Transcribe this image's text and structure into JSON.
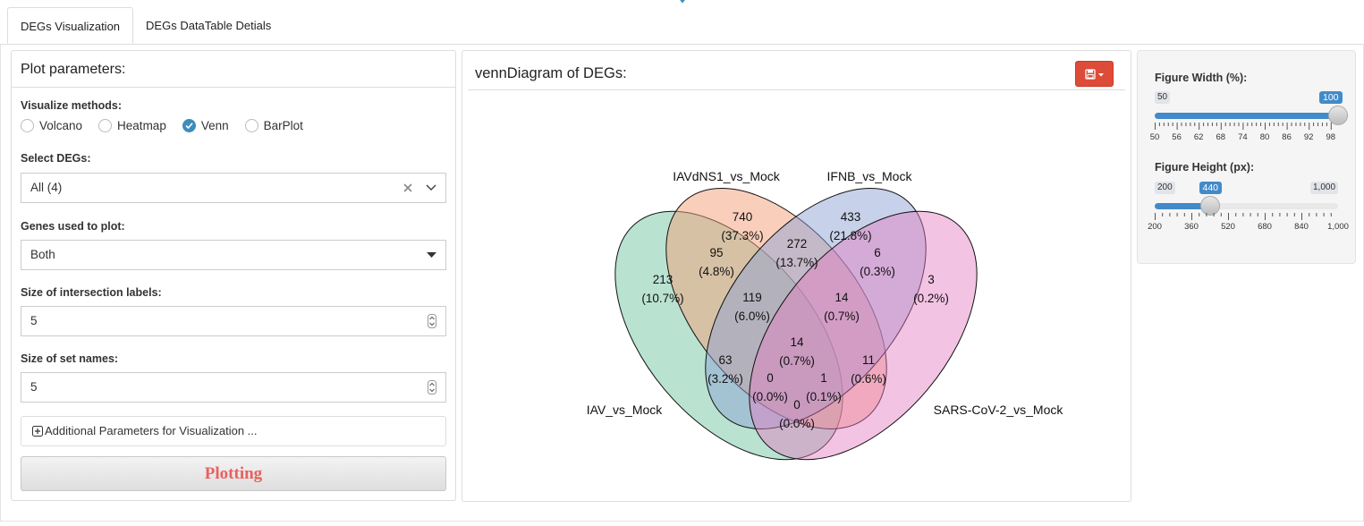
{
  "tabs": [
    {
      "label": "DEGs Visualization",
      "active": true
    },
    {
      "label": "DEGs DataTable Detials",
      "active": false
    }
  ],
  "params": {
    "title": "Plot parameters:",
    "methods_label": "Visualize methods:",
    "methods": [
      {
        "label": "Volcano",
        "checked": false
      },
      {
        "label": "Heatmap",
        "checked": false
      },
      {
        "label": "Venn",
        "checked": true
      },
      {
        "label": "BarPlot",
        "checked": false
      }
    ],
    "degs_label": "Select DEGs:",
    "degs_value": "All (4)",
    "genes_label": "Genes used to plot:",
    "genes_value": "Both",
    "intersect_label": "Size of intersection labels:",
    "intersect_value": "5",
    "setnames_label": "Size of set names:",
    "setnames_value": "5",
    "additional_label": "Additional Parameters for Visualization ...",
    "plot_button": "Plotting"
  },
  "venn_panel": {
    "title": "vennDiagram of DEGs:",
    "save_icon": "floppy-disk-icon",
    "save_color": "#dd4b39"
  },
  "venn": {
    "sets": [
      {
        "name": "IAV_vs_Mock",
        "color": "#74c6a4"
      },
      {
        "name": "IAVdNS1_vs_Mock",
        "color": "#f4a07a"
      },
      {
        "name": "IFNB_vs_Mock",
        "color": "#8fa4d4"
      },
      {
        "name": "SARS-CoV-2_vs_Mock",
        "color": "#e57ac0"
      }
    ],
    "regions": [
      {
        "count": "740",
        "pct": "(37.3%)"
      },
      {
        "count": "433",
        "pct": "(21.8%)"
      },
      {
        "count": "95",
        "pct": "(4.8%)"
      },
      {
        "count": "272",
        "pct": "(13.7%)"
      },
      {
        "count": "6",
        "pct": "(0.3%)"
      },
      {
        "count": "213",
        "pct": "(10.7%)"
      },
      {
        "count": "3",
        "pct": "(0.2%)"
      },
      {
        "count": "119",
        "pct": "(6.0%)"
      },
      {
        "count": "14",
        "pct": "(0.7%)"
      },
      {
        "count": "14",
        "pct": "(0.7%)"
      },
      {
        "count": "63",
        "pct": "(3.2%)"
      },
      {
        "count": "11",
        "pct": "(0.6%)"
      },
      {
        "count": "0",
        "pct": "(0.0%)"
      },
      {
        "count": "1",
        "pct": "(0.1%)"
      },
      {
        "count": "0",
        "pct": "(0.0%)"
      }
    ]
  },
  "sliders": {
    "width": {
      "label": "Figure Width (%):",
      "min": "50",
      "max": "100",
      "value": "100",
      "fraction": 1.0,
      "ticks": [
        "50",
        "56",
        "62",
        "68",
        "74",
        "80",
        "86",
        "92",
        "98"
      ]
    },
    "height": {
      "label": "Figure Height (px):",
      "min": "200",
      "max": "1,000",
      "value": "440",
      "fraction": 0.3,
      "ticks": [
        "200",
        "360",
        "520",
        "680",
        "840",
        "1,000"
      ]
    },
    "accent": "#428bca"
  }
}
